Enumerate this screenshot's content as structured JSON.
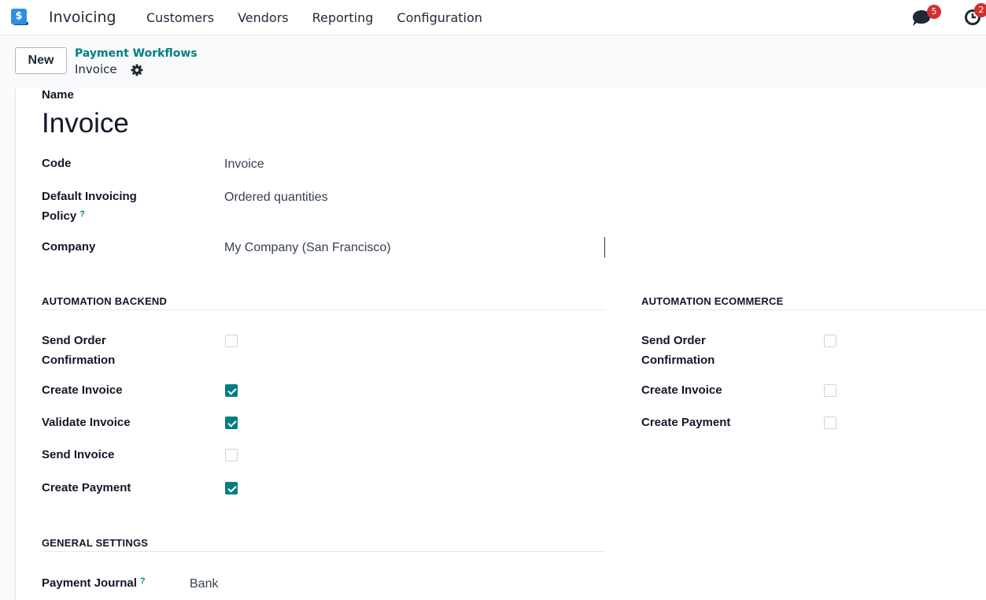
{
  "navbar": {
    "app_icon_glyph": "$",
    "app_name": "Invoicing",
    "menu": [
      "Customers",
      "Vendors",
      "Reporting",
      "Configuration"
    ],
    "messages_badge": "5",
    "activities_badge": "2"
  },
  "control_panel": {
    "new_label": "New",
    "breadcrumb_parent": "Payment Workflows",
    "breadcrumb_current": "Invoice"
  },
  "form": {
    "name_label": "Name",
    "name_value": "Invoice",
    "code_label": "Code",
    "code_value": "Invoice",
    "policy_label_line1": "Default Invoicing",
    "policy_label_line2": "Policy",
    "policy_value": "Ordered quantities",
    "company_label": "Company",
    "company_value": "My Company (San Francisco)",
    "help_mark": "?",
    "automation_backend": {
      "title": "AUTOMATION BACKEND",
      "items": [
        {
          "label": "Send Order",
          "label2": "Confirmation",
          "checked": false
        },
        {
          "label": "Create Invoice",
          "checked": true
        },
        {
          "label": "Validate Invoice",
          "checked": true
        },
        {
          "label": "Send Invoice",
          "checked": false
        },
        {
          "label": "Create Payment",
          "checked": true
        }
      ]
    },
    "automation_ecommerce": {
      "title": "AUTOMATION ECOMMERCE",
      "items": [
        {
          "label": "Send Order",
          "label2": "Confirmation",
          "checked": false
        },
        {
          "label": "Create Invoice",
          "checked": false
        },
        {
          "label": "Create Payment",
          "checked": false
        }
      ]
    },
    "general_settings": {
      "title": "GENERAL SETTINGS",
      "payment_journal_label": "Payment Journal",
      "payment_journal_value": "Bank"
    }
  },
  "colors": {
    "accent": "#017e84",
    "badge": "#d32f2f",
    "app_icon": "#2d8ee3"
  }
}
